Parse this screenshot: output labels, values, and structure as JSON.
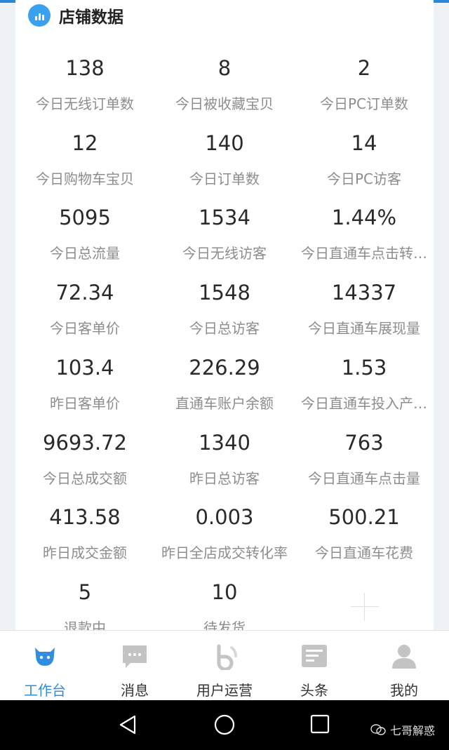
{
  "card": {
    "title": "店铺数据"
  },
  "metrics": [
    {
      "value": "138",
      "label": "今日无线订单数"
    },
    {
      "value": "8",
      "label": "今日被收藏宝贝"
    },
    {
      "value": "2",
      "label": "今日PC订单数"
    },
    {
      "value": "12",
      "label": "今日购物车宝贝"
    },
    {
      "value": "140",
      "label": "今日订单数"
    },
    {
      "value": "14",
      "label": "今日PC访客"
    },
    {
      "value": "5095",
      "label": "今日总流量"
    },
    {
      "value": "1534",
      "label": "今日无线访客"
    },
    {
      "value": "1.44%",
      "label": "今日直通车点击转…"
    },
    {
      "value": "72.34",
      "label": "今日客单价"
    },
    {
      "value": "1548",
      "label": "今日总访客"
    },
    {
      "value": "14337",
      "label": "今日直通车展现量"
    },
    {
      "value": "103.4",
      "label": "昨日客单价"
    },
    {
      "value": "226.29",
      "label": "直通车账户余额"
    },
    {
      "value": "1.53",
      "label": "今日直通车投入产…"
    },
    {
      "value": "9693.72",
      "label": "今日总成交额"
    },
    {
      "value": "1340",
      "label": "昨日总访客"
    },
    {
      "value": "763",
      "label": "今日直通车点击量"
    },
    {
      "value": "413.58",
      "label": "昨日成交金额"
    },
    {
      "value": "0.003",
      "label": "昨日全店成交转化率"
    },
    {
      "value": "500.21",
      "label": "今日直通车花费"
    },
    {
      "value": "5",
      "label": "退款中"
    },
    {
      "value": "10",
      "label": "待发货"
    }
  ],
  "tabs": [
    {
      "label": "工作台",
      "icon": "cow-icon",
      "active": true
    },
    {
      "label": "消息",
      "icon": "message-icon",
      "active": false
    },
    {
      "label": "用户运营",
      "icon": "user-ops-icon",
      "active": false
    },
    {
      "label": "头条",
      "icon": "news-icon",
      "active": false
    },
    {
      "label": "我的",
      "icon": "profile-icon",
      "active": false
    }
  ],
  "watermark": {
    "text": "七哥解惑"
  },
  "colors": {
    "accent": "#2f8ee0",
    "label_gray": "#8d8d8d",
    "icon_gray": "#c4c4c4"
  }
}
